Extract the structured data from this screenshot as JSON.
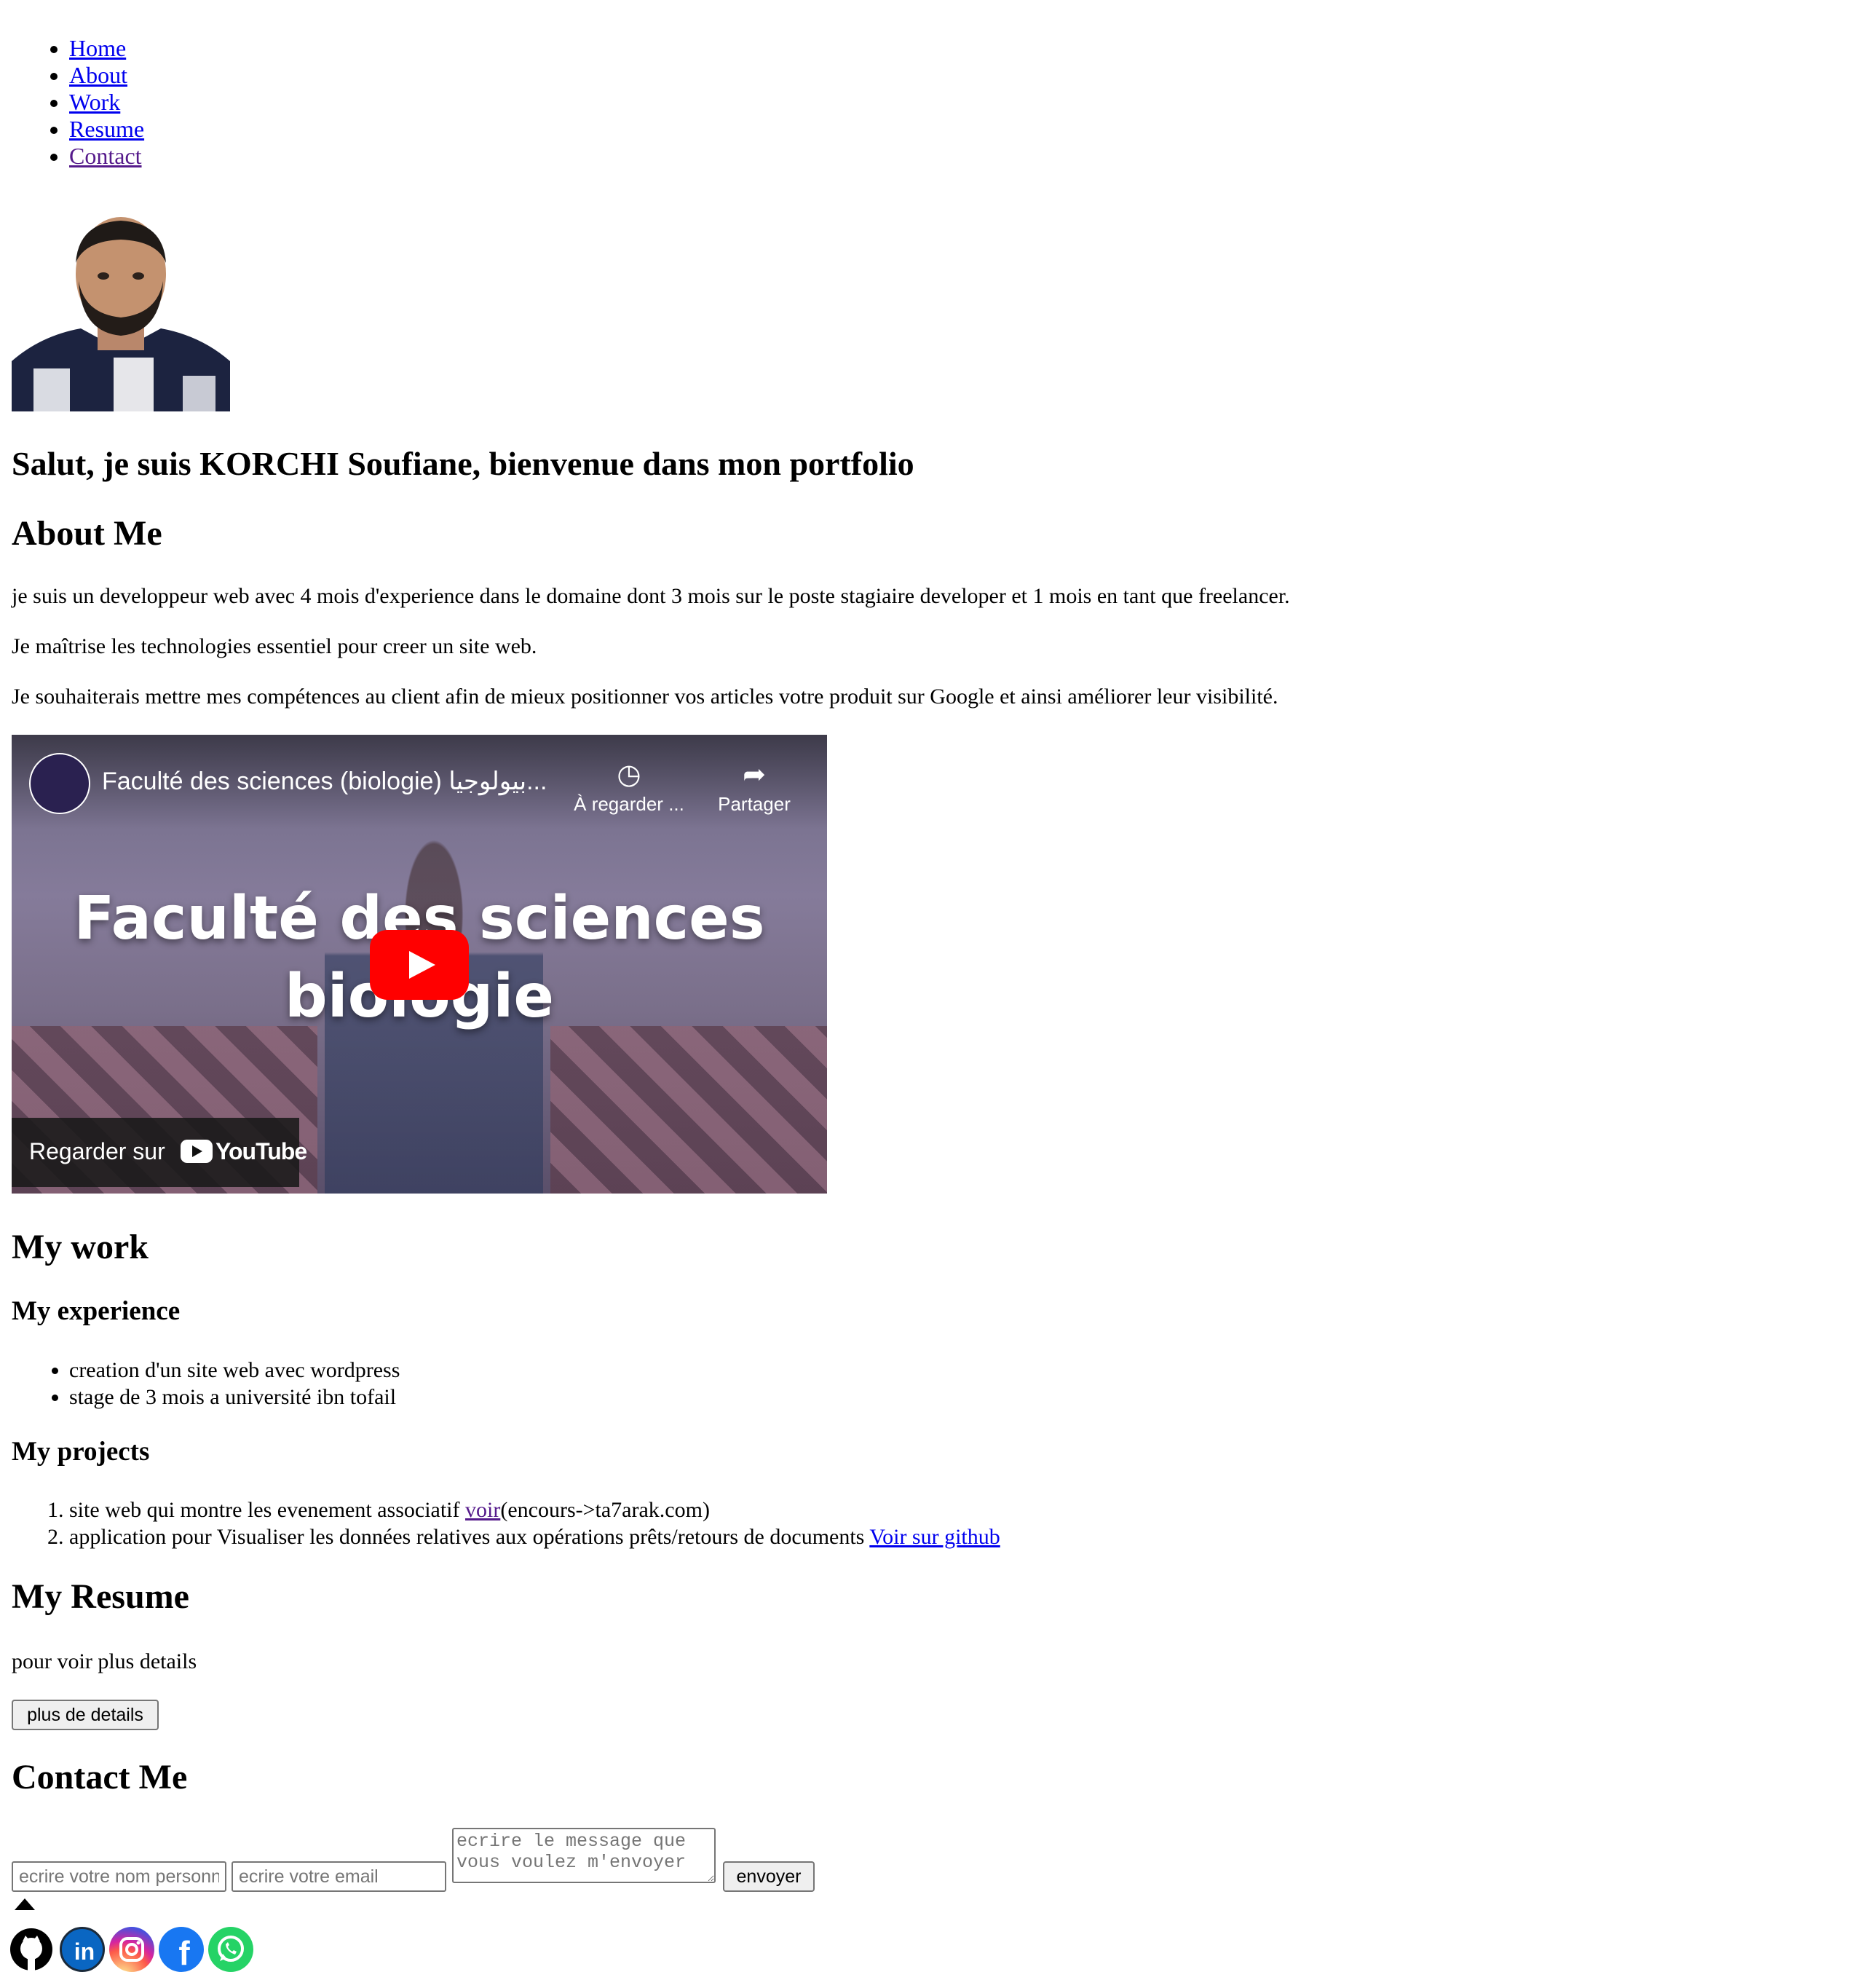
{
  "nav": {
    "items": [
      {
        "label": "Home"
      },
      {
        "label": "About"
      },
      {
        "label": "Work"
      },
      {
        "label": "Resume"
      },
      {
        "label": "Contact"
      }
    ]
  },
  "hero": {
    "title": "Salut, je suis KORCHI Soufiane, bienvenue dans mon portfolio"
  },
  "about": {
    "heading": "About Me",
    "paragraphs": [
      "je suis un developpeur web avec 4 mois d'experience dans le domaine dont 3 mois sur le poste stagiaire developer et 1 mois en tant que freelancer.",
      "Je maîtrise les technologies essentiel pour creer un site web.",
      "Je souhaiterais mettre mes compétences au client afin de mieux positionner vos articles votre produit sur Google et ainsi améliorer leur visibilité."
    ],
    "video": {
      "title": "Faculté des sciences (biologie) بيولوجيا...",
      "watch_later": "À regarder ...",
      "share": "Partager",
      "overlay_line1": "Faculté des sciences",
      "overlay_line2": "biologie",
      "watch_on": "Regarder sur",
      "youtube": "YouTube"
    }
  },
  "work": {
    "heading": "My work",
    "experience_heading": "My experience",
    "experience": [
      "creation d'un site web avec wordpress",
      "stage de 3 mois a université ibn tofail"
    ],
    "projects_heading": "My projects",
    "projects": [
      {
        "text": "site web qui montre les evenement associatif ",
        "link": "voir",
        "suffix": "(encours->ta7arak.com)"
      },
      {
        "text": "application pour Visualiser les données relatives aux opérations prêts/retours de documents ",
        "link": "Voir sur github",
        "suffix": ""
      }
    ]
  },
  "resume": {
    "heading": "My Resume",
    "text": "pour voir plus details",
    "button": "plus de details"
  },
  "contact": {
    "heading": "Contact Me",
    "name_placeholder": "ecrire votre nom personnel",
    "email_placeholder": "ecrire votre email",
    "message_placeholder": "ecrire le message que vous voulez m'envoyer",
    "send": "envoyer"
  },
  "social": {
    "icons": [
      "github-icon",
      "linkedin-icon",
      "instagram-icon",
      "facebook-icon",
      "whatsapp-icon"
    ]
  }
}
